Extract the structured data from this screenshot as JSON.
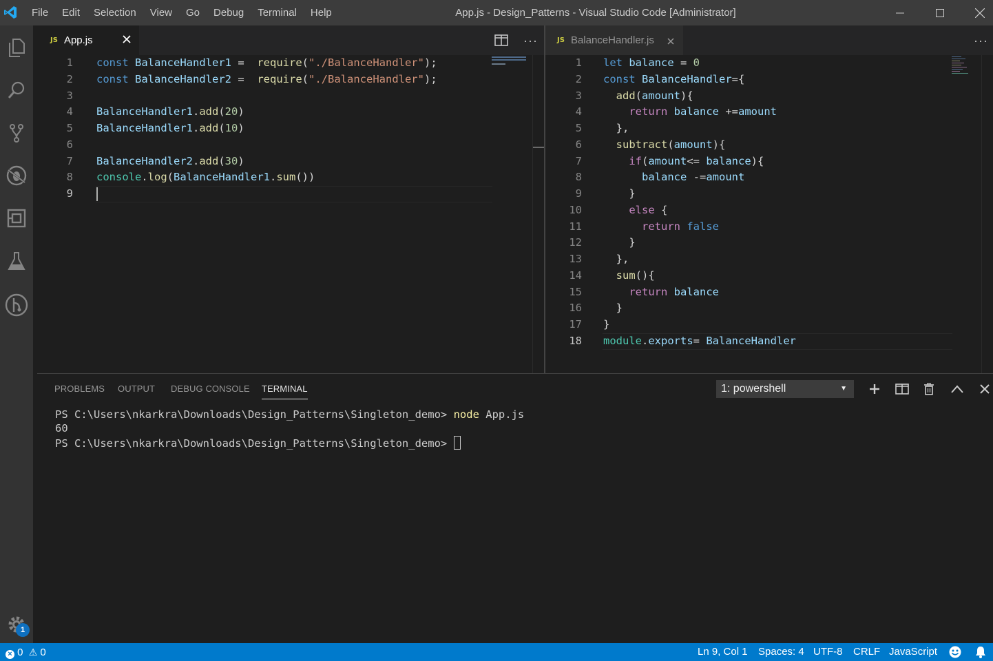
{
  "window": {
    "title": "App.js - Design_Patterns - Visual Studio Code [Administrator]",
    "menu": [
      "File",
      "Edit",
      "Selection",
      "View",
      "Go",
      "Debug",
      "Terminal",
      "Help"
    ]
  },
  "activity_bar": {
    "items": [
      "explorer-icon",
      "search-icon",
      "source-control-icon",
      "debug-icon",
      "extensions-icon",
      "test-icon",
      "gitlens-icon"
    ],
    "settings_badge": "1"
  },
  "left_editor": {
    "tab_badge": "JS",
    "tab_label": "App.js",
    "lines": [
      {
        "n": "1",
        "tokens": [
          [
            "kw",
            "const"
          ],
          [
            "plain",
            " "
          ],
          [
            "var",
            "BalanceHandler1"
          ],
          [
            "plain",
            " =  "
          ],
          [
            "fn",
            "require"
          ],
          [
            "plain",
            "("
          ],
          [
            "str",
            "\"./BalanceHandler\""
          ],
          [
            "plain",
            ");"
          ]
        ]
      },
      {
        "n": "2",
        "tokens": [
          [
            "kw",
            "const"
          ],
          [
            "plain",
            " "
          ],
          [
            "var",
            "BalanceHandler2"
          ],
          [
            "plain",
            " =  "
          ],
          [
            "fn",
            "require"
          ],
          [
            "plain",
            "("
          ],
          [
            "str",
            "\"./BalanceHandler\""
          ],
          [
            "plain",
            ");"
          ]
        ]
      },
      {
        "n": "3",
        "tokens": []
      },
      {
        "n": "4",
        "tokens": [
          [
            "var",
            "BalanceHandler1"
          ],
          [
            "plain",
            "."
          ],
          [
            "fn",
            "add"
          ],
          [
            "plain",
            "("
          ],
          [
            "num",
            "20"
          ],
          [
            "plain",
            ")"
          ]
        ]
      },
      {
        "n": "5",
        "tokens": [
          [
            "var",
            "BalanceHandler1"
          ],
          [
            "plain",
            "."
          ],
          [
            "fn",
            "add"
          ],
          [
            "plain",
            "("
          ],
          [
            "num",
            "10"
          ],
          [
            "plain",
            ")"
          ]
        ]
      },
      {
        "n": "6",
        "tokens": []
      },
      {
        "n": "7",
        "tokens": [
          [
            "var",
            "BalanceHandler2"
          ],
          [
            "plain",
            "."
          ],
          [
            "fn",
            "add"
          ],
          [
            "plain",
            "("
          ],
          [
            "num",
            "30"
          ],
          [
            "plain",
            ")"
          ]
        ]
      },
      {
        "n": "8",
        "tokens": [
          [
            "cls",
            "console"
          ],
          [
            "plain",
            "."
          ],
          [
            "fn",
            "log"
          ],
          [
            "plain",
            "("
          ],
          [
            "var",
            "BalanceHandler1"
          ],
          [
            "plain",
            "."
          ],
          [
            "fn",
            "sum"
          ],
          [
            "plain",
            "())"
          ]
        ]
      },
      {
        "n": "9",
        "tokens": []
      }
    ],
    "active_line": "9"
  },
  "right_editor": {
    "tab_badge": "JS",
    "tab_label": "BalanceHandler.js",
    "lines": [
      {
        "n": "1",
        "tokens": [
          [
            "kw",
            "let"
          ],
          [
            "plain",
            " "
          ],
          [
            "var",
            "balance"
          ],
          [
            "plain",
            " = "
          ],
          [
            "num",
            "0"
          ]
        ]
      },
      {
        "n": "2",
        "tokens": [
          [
            "kw",
            "const"
          ],
          [
            "plain",
            " "
          ],
          [
            "var",
            "BalanceHandler"
          ],
          [
            "plain",
            "={"
          ]
        ]
      },
      {
        "n": "3",
        "tokens": [
          [
            "plain",
            "  "
          ],
          [
            "fn",
            "add"
          ],
          [
            "plain",
            "("
          ],
          [
            "var",
            "amount"
          ],
          [
            "plain",
            "){"
          ]
        ]
      },
      {
        "n": "4",
        "tokens": [
          [
            "plain",
            "    "
          ],
          [
            "ctl",
            "return"
          ],
          [
            "plain",
            " "
          ],
          [
            "var",
            "balance"
          ],
          [
            "plain",
            " +="
          ],
          [
            "var",
            "amount"
          ]
        ]
      },
      {
        "n": "5",
        "tokens": [
          [
            "plain",
            "  },"
          ]
        ]
      },
      {
        "n": "6",
        "tokens": [
          [
            "plain",
            "  "
          ],
          [
            "fn",
            "subtract"
          ],
          [
            "plain",
            "("
          ],
          [
            "var",
            "amount"
          ],
          [
            "plain",
            "){"
          ]
        ]
      },
      {
        "n": "7",
        "tokens": [
          [
            "plain",
            "    "
          ],
          [
            "ctl",
            "if"
          ],
          [
            "plain",
            "("
          ],
          [
            "var",
            "amount"
          ],
          [
            "plain",
            "<= "
          ],
          [
            "var",
            "balance"
          ],
          [
            "plain",
            "){"
          ]
        ]
      },
      {
        "n": "8",
        "tokens": [
          [
            "plain",
            "      "
          ],
          [
            "var",
            "balance"
          ],
          [
            "plain",
            " -="
          ],
          [
            "var",
            "amount"
          ]
        ]
      },
      {
        "n": "9",
        "tokens": [
          [
            "plain",
            "    }"
          ]
        ]
      },
      {
        "n": "10",
        "tokens": [
          [
            "plain",
            "    "
          ],
          [
            "ctl",
            "else"
          ],
          [
            "plain",
            " {"
          ]
        ]
      },
      {
        "n": "11",
        "tokens": [
          [
            "plain",
            "      "
          ],
          [
            "ctl",
            "return"
          ],
          [
            "plain",
            " "
          ],
          [
            "kw",
            "false"
          ]
        ]
      },
      {
        "n": "12",
        "tokens": [
          [
            "plain",
            "    }"
          ]
        ]
      },
      {
        "n": "13",
        "tokens": [
          [
            "plain",
            "  },"
          ]
        ]
      },
      {
        "n": "14",
        "tokens": [
          [
            "plain",
            "  "
          ],
          [
            "fn",
            "sum"
          ],
          [
            "plain",
            "(){"
          ]
        ]
      },
      {
        "n": "15",
        "tokens": [
          [
            "plain",
            "    "
          ],
          [
            "ctl",
            "return"
          ],
          [
            "plain",
            " "
          ],
          [
            "var",
            "balance"
          ]
        ]
      },
      {
        "n": "16",
        "tokens": [
          [
            "plain",
            "  }"
          ]
        ]
      },
      {
        "n": "17",
        "tokens": [
          [
            "plain",
            "}"
          ]
        ]
      },
      {
        "n": "18",
        "tokens": [
          [
            "cls",
            "module"
          ],
          [
            "plain",
            "."
          ],
          [
            "var",
            "exports"
          ],
          [
            "plain",
            "= "
          ],
          [
            "var",
            "BalanceHandler"
          ]
        ]
      }
    ],
    "active_line": "18"
  },
  "panel": {
    "tabs": [
      "PROBLEMS",
      "OUTPUT",
      "DEBUG CONSOLE",
      "TERMINAL"
    ],
    "active_tab": "TERMINAL",
    "terminal_select": "1: powershell",
    "terminal": {
      "prompt": "PS C:\\Users\\nkarkra\\Downloads\\Design_Patterns\\Singleton_demo> ",
      "command": "node",
      "command_arg": " App.js",
      "output": "60",
      "prompt2": "PS C:\\Users\\nkarkra\\Downloads\\Design_Patterns\\Singleton_demo> "
    }
  },
  "status_bar": {
    "errors": "0",
    "warnings": "0",
    "position": "Ln 9, Col 1",
    "spaces": "Spaces: 4",
    "encoding": "UTF-8",
    "eol": "CRLF",
    "language": "JavaScript"
  },
  "colors": {
    "accent": "#007acc",
    "keyword": "#569cd6",
    "control": "#c586c0",
    "variable": "#9cdcfe",
    "function": "#dcdcaa",
    "string": "#ce9178",
    "number": "#b5cea8"
  }
}
